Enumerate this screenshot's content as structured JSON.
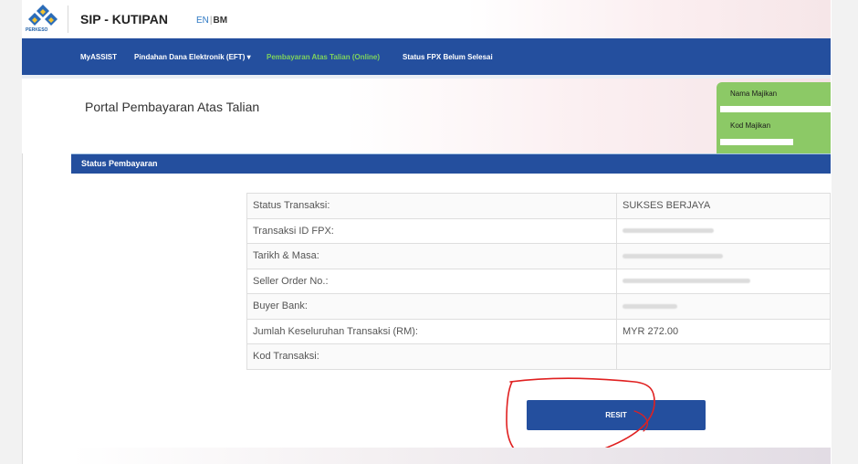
{
  "header": {
    "logo_text": "PERKESO",
    "app_title": "SIP - KUTIPAN",
    "lang_en": "EN",
    "lang_sep": "|",
    "lang_bm": "BM"
  },
  "nav": {
    "items": [
      {
        "label": "MyASSIST"
      },
      {
        "label": "Pindahan Dana Elektronik (EFT) ▾"
      },
      {
        "label": "Pembayaran Atas Talian (Online)"
      },
      {
        "label": "Status FPX Belum Selesai"
      }
    ]
  },
  "page_title": "Portal Pembayaran Atas Talian",
  "employer": {
    "name_label": "Nama Majikan",
    "code_label": "Kod Majikan"
  },
  "section": {
    "title": "Status Pembayaran"
  },
  "details": {
    "rows": [
      {
        "label": "Status Transaksi:",
        "value": "SUKSES BERJAYA"
      },
      {
        "label": "Transaksi ID FPX:",
        "value": ""
      },
      {
        "label": "Tarikh & Masa:",
        "value": ""
      },
      {
        "label": "Seller Order No.:",
        "value": ""
      },
      {
        "label": "Buyer Bank:",
        "value": ""
      },
      {
        "label": "Jumlah Keseluruhan Transaksi (RM):",
        "value": "MYR 272.00"
      },
      {
        "label": "Kod Transaksi:",
        "value": ""
      }
    ]
  },
  "actions": {
    "resit_label": "RESIT"
  },
  "colors": {
    "primary": "#244f9e",
    "accent_green": "#8cc966",
    "active_nav": "#7fd35d",
    "annotation_red": "#e02020"
  }
}
